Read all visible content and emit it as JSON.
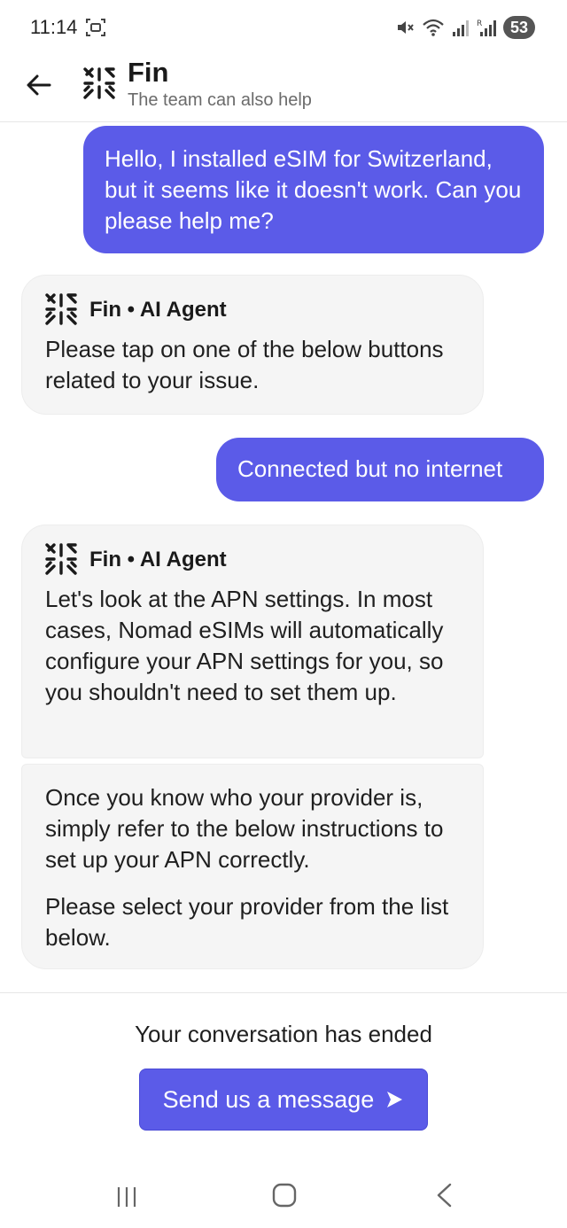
{
  "status_bar": {
    "time": "11:14",
    "battery": "53"
  },
  "header": {
    "title": "Fin",
    "subtitle": "The team can also help"
  },
  "messages": {
    "user_1": "Hello, I installed eSIM for Switzerland, but it seems like it doesn't work. Can you please help me?",
    "agent_1": {
      "sender": "Fin • AI Agent",
      "text": "Please tap on one of the below buttons related to your issue."
    },
    "user_2": "Connected but no internet",
    "agent_2": {
      "sender": "Fin • AI Agent",
      "text": "Let's look at the APN settings. In most cases, Nomad eSIMs will automatically configure your APN settings for you, so you shouldn't need to set them up."
    },
    "agent_3": {
      "paragraph_1": "Once you know who your provider is, simply refer to the below instructions to set up your APN correctly.",
      "paragraph_2": "Please select your provider from the list below."
    }
  },
  "footer": {
    "ended_text": "Your conversation has ended",
    "send_label": "Send us a message"
  },
  "colors": {
    "accent": "#5b5be8",
    "agent_bubble": "#f5f5f5"
  },
  "icons": {
    "back": "arrow-left-icon",
    "logo": "fin-logo-icon",
    "send": "send-arrow-icon",
    "nav_recents": "recents-icon",
    "nav_home": "home-icon",
    "nav_back": "chevron-left-icon"
  }
}
